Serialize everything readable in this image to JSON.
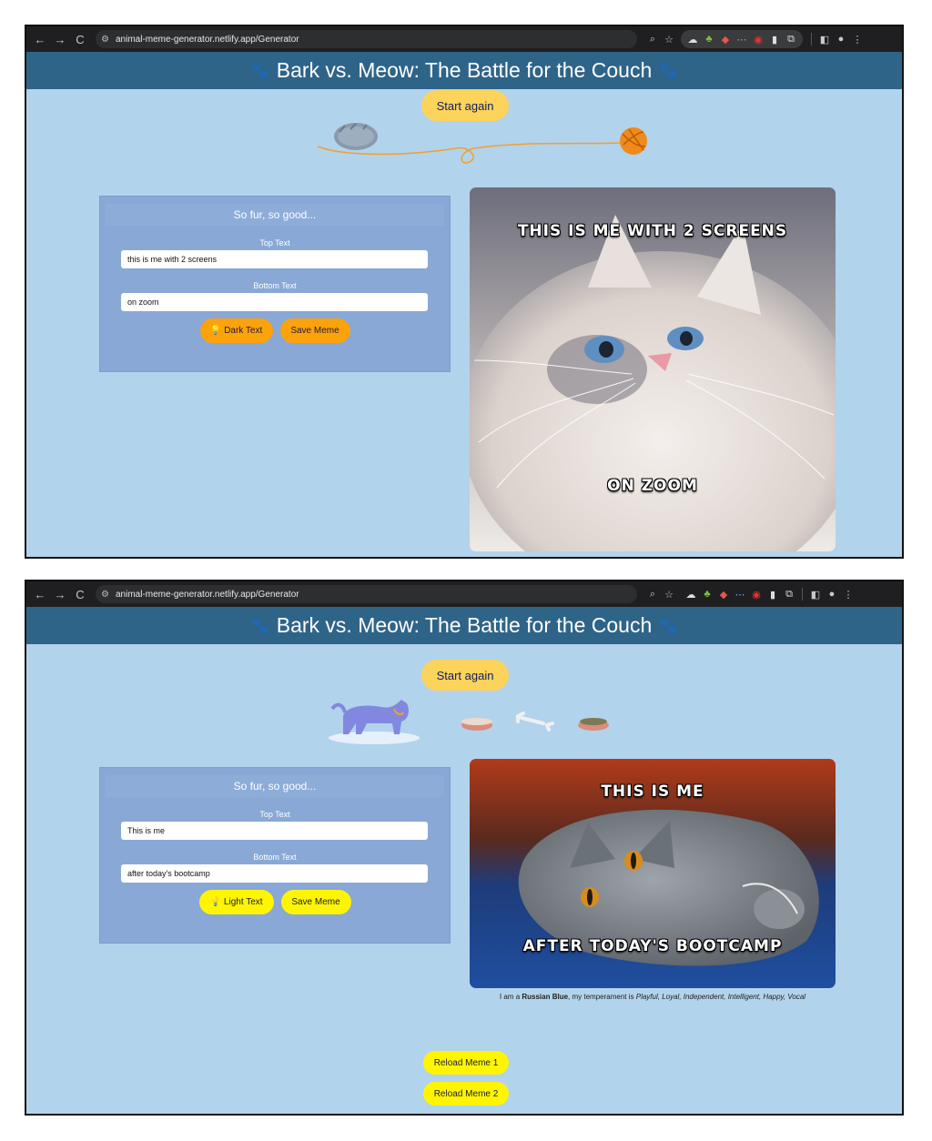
{
  "browser": {
    "url": "animal-meme-generator.netlify.app/Generator",
    "nav": {
      "back": "←",
      "forward": "→",
      "reload": "C"
    }
  },
  "app": {
    "title": "Bark vs. Meow: The Battle for the Couch",
    "start_again": "Start again"
  },
  "screen1": {
    "panel_title": "So fur, so good...",
    "top_label": "Top Text",
    "top_value": "this is me with 2 screens",
    "bottom_label": "Bottom Text",
    "bottom_value": "on zoom",
    "toggle_label": "Dark Text",
    "save_label": "Save Meme",
    "meme_top": "THIS IS ME WITH 2 SCREENS",
    "meme_bottom": "ON ZOOM",
    "colors": {
      "button": "#fca20a"
    }
  },
  "screen2": {
    "panel_title": "So fur, so good...",
    "top_label": "Top Text",
    "top_value": "This is me",
    "bottom_label": "Bottom Text",
    "bottom_value": "after today's bootcamp",
    "toggle_label": "Light Text",
    "save_label": "Save Meme",
    "meme_top": "THIS IS ME",
    "meme_bottom": "AFTER TODAY'S BOOTCAMP",
    "caption": {
      "prefix": "I am a ",
      "breed": "Russian Blue",
      "middle": ", my temperament is ",
      "temperament": "Playful, Loyal, Independent, Intelligent, Happy, Vocal"
    },
    "reload1": "Reload Meme 1",
    "reload2": "Reload Meme 2",
    "colors": {
      "button": "#fff500"
    }
  }
}
